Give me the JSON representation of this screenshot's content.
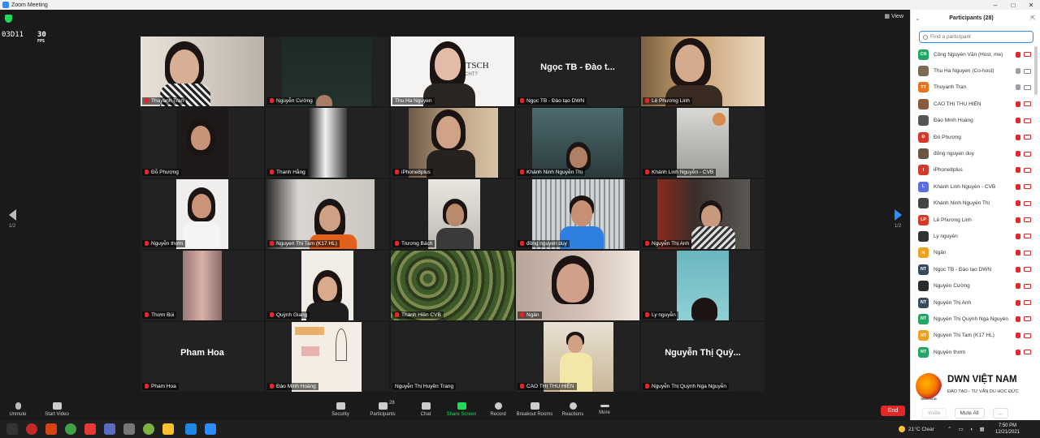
{
  "window": {
    "title": "Zoom Meeting"
  },
  "stats": {
    "code": "03D11",
    "fps_value": "30",
    "fps_unit": "FPS"
  },
  "view_label": "View",
  "page_indicator": {
    "left": "1/2",
    "right": "1/2"
  },
  "tiles": [
    {
      "label": "Thuyanh Tran",
      "kind": "video",
      "mic": false
    },
    {
      "label": "Nguyễn Cường",
      "kind": "video",
      "mic": true
    },
    {
      "label": "Thu Ha Nguyen",
      "kind": "video",
      "mic": false,
      "active": true,
      "overlay": "DEUTSCH / ...4 NICHT?"
    },
    {
      "label": "Ngọc TB - Đào tạo DWN",
      "kind": "name",
      "big": "Ngọc TB - Đào t...",
      "mic": true
    },
    {
      "label": "Lê Phương Linh",
      "kind": "video",
      "mic": true
    },
    {
      "label": "Đỗ Phượng",
      "kind": "video",
      "mic": true
    },
    {
      "label": "Thanh Hằng",
      "kind": "video",
      "mic": true
    },
    {
      "label": "iPhone8plus",
      "kind": "video",
      "mic": true
    },
    {
      "label": "Khánh Ninh Nguyễn Thị",
      "kind": "video",
      "mic": true
    },
    {
      "label": "Khánh Linh Nguyễn - CVB",
      "kind": "video",
      "mic": true
    },
    {
      "label": "Nguyễn thơm",
      "kind": "video",
      "mic": true
    },
    {
      "label": "Nguyen Thi Tam (K17 HL)",
      "kind": "video",
      "mic": true
    },
    {
      "label": "Trương Bách",
      "kind": "video",
      "mic": true
    },
    {
      "label": "đông nguyen duy",
      "kind": "video",
      "mic": true
    },
    {
      "label": "Nguyễn Thị Anh",
      "kind": "video",
      "mic": true
    },
    {
      "label": "Thơm Bùi",
      "kind": "video",
      "mic": true
    },
    {
      "label": "Quỳnh Giang",
      "kind": "video",
      "mic": true
    },
    {
      "label": "Thanh Hiền CVB",
      "kind": "video",
      "mic": true
    },
    {
      "label": "Ngân",
      "kind": "video",
      "mic": true
    },
    {
      "label": "Ly nguyễn",
      "kind": "video",
      "mic": true
    },
    {
      "label": "Pham Hoa",
      "kind": "name",
      "big": "Pham Hoa",
      "mic": true
    },
    {
      "label": "Đào Minh Hoàng",
      "kind": "video",
      "mic": true
    },
    {
      "label": "Nguyễn Thị Huyền Trang",
      "kind": "name",
      "big": "",
      "mic": false
    },
    {
      "label": "CAO THỊ THU HIỀN",
      "kind": "video",
      "mic": true
    },
    {
      "label": "Nguyễn Thị Quỳnh Nga Nguyễn",
      "kind": "name",
      "big": "Nguyễn Thị Quỳ...",
      "mic": true
    }
  ],
  "toolbar": {
    "unmute": "Unmute",
    "start_video": "Start Video",
    "security": "Security",
    "participants": "Participants",
    "participants_count": "28",
    "chat": "Chat",
    "share_screen": "Share Screen",
    "record": "Record",
    "breakout_rooms": "Breakout Rooms",
    "reactions": "Reactions",
    "more": "More",
    "end": "End"
  },
  "panel": {
    "title": "Participants (28)",
    "search_placeholder": "Find a participant",
    "participants": [
      {
        "initials": "CN",
        "color": "#23a566",
        "name": "Công Nguyễn Văn (Host, me)",
        "mic_on": false,
        "cam_on": false
      },
      {
        "initials": "",
        "color": "#7a6a55",
        "name": "Thu Ha Nguyen (Co-host)",
        "mic_on": true,
        "cam_on": true
      },
      {
        "initials": "TT",
        "color": "#e8731a",
        "name": "Thuyanh Tran",
        "mic_on": true,
        "cam_on": true
      },
      {
        "initials": "",
        "color": "#8a5a3c",
        "name": "CAO THỊ THU HIỀN",
        "mic_on": false,
        "cam_on": false
      },
      {
        "initials": "",
        "color": "#555555",
        "name": "Đào Minh Hoàng",
        "mic_on": false,
        "cam_on": false
      },
      {
        "initials": "Đ",
        "color": "#d43a2a",
        "name": "Đỗ Phượng",
        "mic_on": false,
        "cam_on": false
      },
      {
        "initials": "",
        "color": "#6b5440",
        "name": "đông nguyen duy",
        "mic_on": false,
        "cam_on": false
      },
      {
        "initials": "I",
        "color": "#d43a2a",
        "name": "iPhone8plus",
        "mic_on": false,
        "cam_on": false
      },
      {
        "initials": "L",
        "color": "#5b6ee1",
        "name": "Khánh Linh Nguyễn - CVB",
        "mic_on": false,
        "cam_on": false
      },
      {
        "initials": "",
        "color": "#444444",
        "name": "Khánh Ninh Nguyễn Thị",
        "mic_on": false,
        "cam_on": false
      },
      {
        "initials": "LP",
        "color": "#d43a2a",
        "name": "Lê Phương Linh",
        "mic_on": false,
        "cam_on": false
      },
      {
        "initials": "",
        "color": "#333333",
        "name": "Ly nguyễn",
        "mic_on": false,
        "cam_on": false
      },
      {
        "initials": "N",
        "color": "#f0a020",
        "name": "Ngân",
        "mic_on": false,
        "cam_on": false
      },
      {
        "initials": "NT",
        "color": "#3a4a5e",
        "name": "Ngọc TB - Đào tạo DWN",
        "mic_on": false,
        "cam_on": false
      },
      {
        "initials": "",
        "color": "#2a2a2a",
        "name": "Nguyễn Cường",
        "mic_on": false,
        "cam_on": false
      },
      {
        "initials": "NT",
        "color": "#3a4a5e",
        "name": "Nguyễn Thị Anh",
        "mic_on": false,
        "cam_on": false
      },
      {
        "initials": "NT",
        "color": "#23a566",
        "name": "Nguyễn Thị Quỳnh Nga Nguyễn",
        "mic_on": false,
        "cam_on": false
      },
      {
        "initials": "NT",
        "color": "#f0a020",
        "name": "Nguyen Thi Tam (K17 HL)",
        "mic_on": false,
        "cam_on": false
      },
      {
        "initials": "NT",
        "color": "#23a566",
        "name": "Nguyễn thơm",
        "mic_on": false,
        "cam_on": false
      }
    ],
    "invite": "Invite",
    "mute_all": "Mute All",
    "more": "..."
  },
  "watermark": {
    "brand": "DWN VIỆT NAM",
    "tagline": "ĐÀO TẠO - TƯ VẤN DU HỌC ĐỨC",
    "logo_text": "DEUTSCH"
  },
  "taskbar": {
    "weather": "21°C  Clear",
    "time": "7:50 PM",
    "date": "12/21/2021"
  },
  "colors": {
    "accent_blue": "#2d8cff",
    "end_red": "#e02828",
    "share_green": "#23d959",
    "active_border": "#c9e23c"
  }
}
